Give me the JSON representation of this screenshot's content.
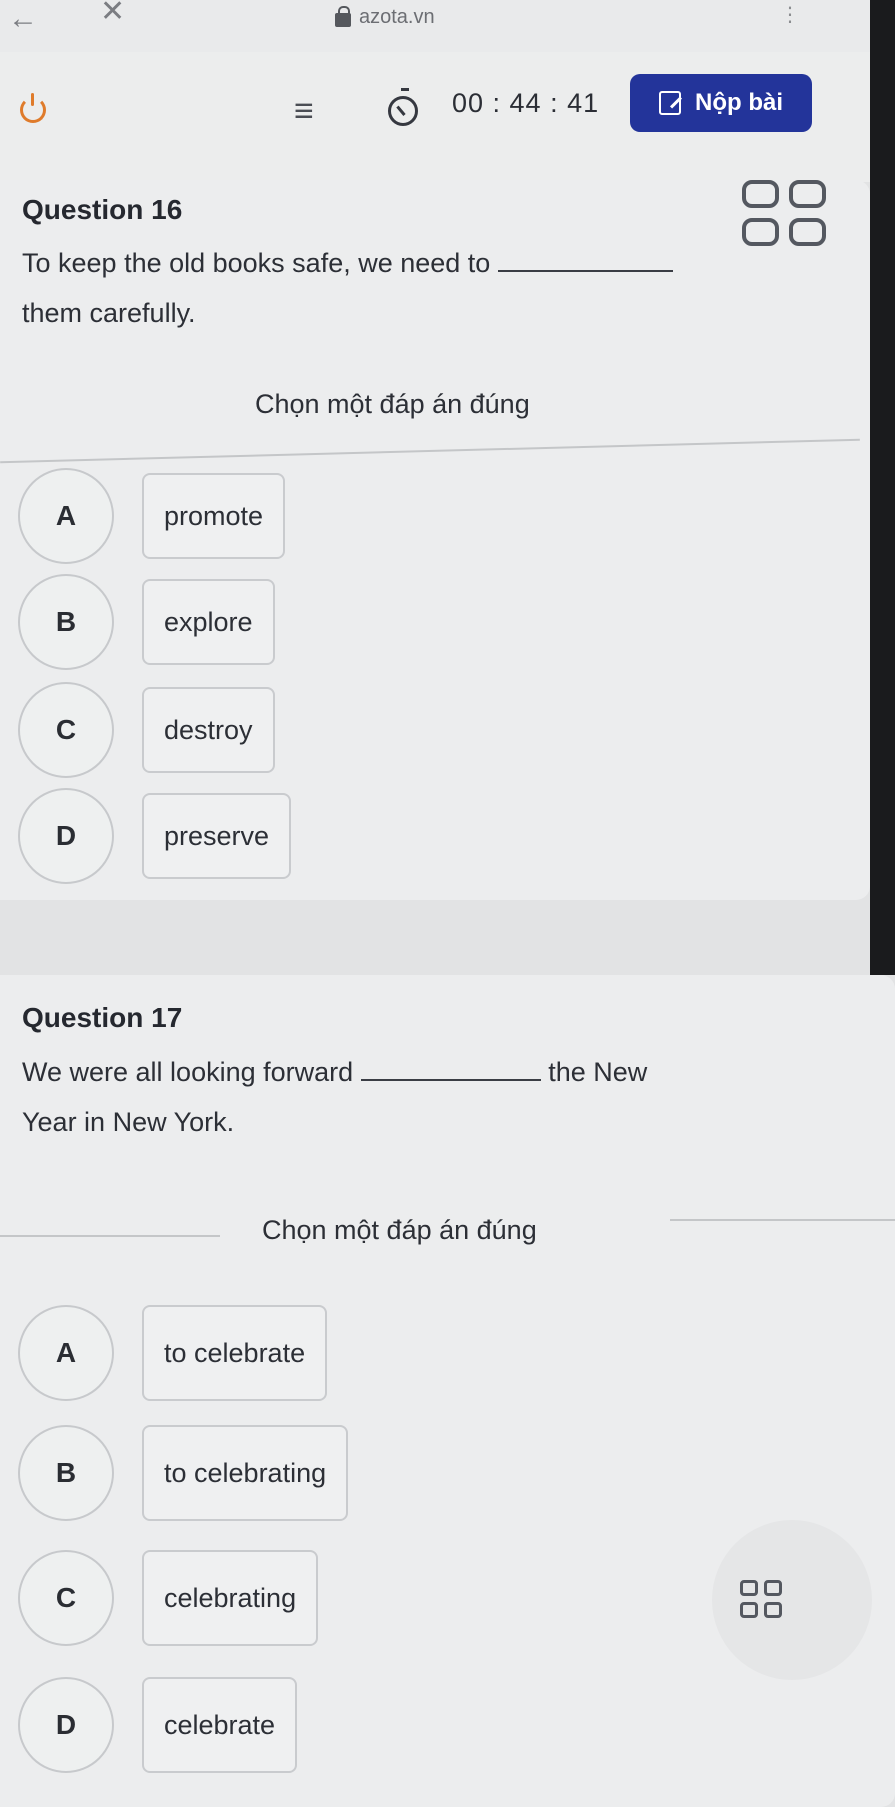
{
  "browser": {
    "url": "azota.vn"
  },
  "toolbar": {
    "timer": "00 : 44 : 41",
    "submit_label": "Nộp bài"
  },
  "questions": [
    {
      "title": "Question 16",
      "text_before": "To keep the old books safe, we need to",
      "text_after": "them carefully.",
      "instruction": "Chọn một đáp án đúng",
      "options": [
        {
          "letter": "A",
          "text": "promote"
        },
        {
          "letter": "B",
          "text": "explore"
        },
        {
          "letter": "C",
          "text": "destroy"
        },
        {
          "letter": "D",
          "text": "preserve"
        }
      ]
    },
    {
      "title": "Question 17",
      "text_before": "We were all looking forward",
      "text_mid": "the New",
      "text_after": "Year in New York.",
      "instruction": "Chọn một đáp án đúng",
      "options": [
        {
          "letter": "A",
          "text": "to celebrate"
        },
        {
          "letter": "B",
          "text": "to celebrating"
        },
        {
          "letter": "C",
          "text": "celebrating"
        },
        {
          "letter": "D",
          "text": "celebrate"
        }
      ]
    }
  ]
}
